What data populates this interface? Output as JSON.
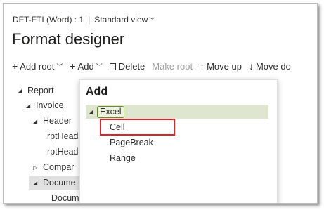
{
  "header": {
    "breadcrumb": "DFT-FTI (Word) : 1",
    "separator": "|",
    "view_label": "Standard view",
    "title": "Format designer"
  },
  "toolbar": {
    "add_root": "Add root",
    "add": "Add",
    "delete": "Delete",
    "make_root": "Make root",
    "move_up": "Move up",
    "move_down": "Move do"
  },
  "tree": {
    "report": "Report",
    "invoice": "Invoice",
    "header": "Header",
    "rpthead1": "rptHead",
    "rpthead2": "rptHead",
    "compan": "Compar",
    "docum": "Docume",
    "docum_child": "Docum"
  },
  "add_popup": {
    "title": "Add",
    "root_item": "Excel",
    "items": [
      "Cell",
      "PageBreak",
      "Range"
    ]
  },
  "colors": {
    "highlight": "#d9262c",
    "excel_bg": "#dfe6cf"
  }
}
